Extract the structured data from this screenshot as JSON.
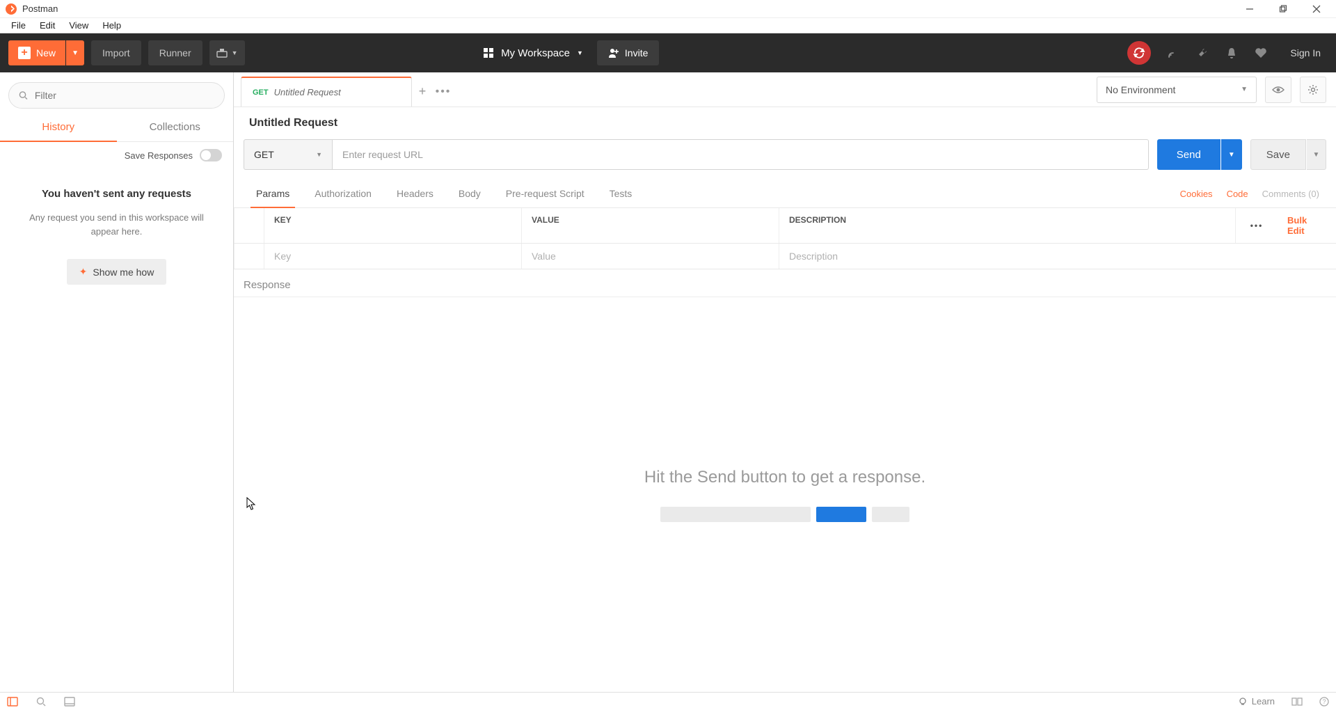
{
  "titlebar": {
    "app_name": "Postman"
  },
  "menubar": {
    "file": "File",
    "edit": "Edit",
    "view": "View",
    "help": "Help"
  },
  "toolbar": {
    "new_label": "New",
    "import_label": "Import",
    "runner_label": "Runner",
    "workspace_label": "My Workspace",
    "invite_label": "Invite",
    "signin_label": "Sign In"
  },
  "sidebar": {
    "filter_placeholder": "Filter",
    "tabs": {
      "history": "History",
      "collections": "Collections"
    },
    "save_responses_label": "Save Responses",
    "empty": {
      "title": "You haven't sent any requests",
      "body": "Any request you send in this workspace will appear here.",
      "show_me_how": "Show me how"
    }
  },
  "tabstrip": {
    "method": "GET",
    "tab_title": "Untitled Request"
  },
  "environment": {
    "selected": "No Environment"
  },
  "request": {
    "name": "Untitled Request",
    "method": "GET",
    "url_placeholder": "Enter request URL",
    "send_label": "Send",
    "save_label": "Save",
    "tabs": {
      "params": "Params",
      "authorization": "Authorization",
      "headers": "Headers",
      "body": "Body",
      "prerequest": "Pre-request Script",
      "tests": "Tests"
    },
    "links": {
      "cookies": "Cookies",
      "code": "Code",
      "comments": "Comments (0)"
    },
    "params_headers": {
      "key": "KEY",
      "value": "VALUE",
      "description": "DESCRIPTION",
      "bulk_edit": "Bulk Edit"
    },
    "params_placeholders": {
      "key": "Key",
      "value": "Value",
      "description": "Description"
    }
  },
  "response": {
    "label": "Response",
    "empty_message": "Hit the Send button to get a response."
  },
  "statusbar": {
    "learn": "Learn"
  },
  "colors": {
    "accent": "#ff6c37",
    "primary_blue": "#1f7ae0",
    "dark_toolbar": "#2b2b2b"
  }
}
